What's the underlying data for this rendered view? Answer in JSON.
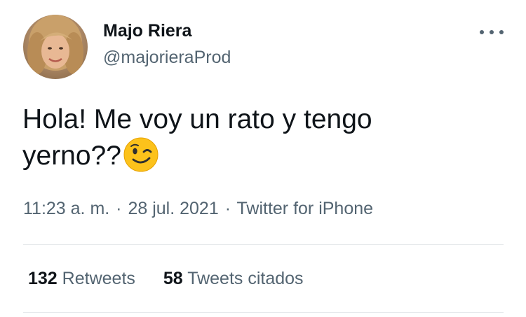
{
  "user": {
    "display_name": "Majo Riera",
    "handle": "@majorieraProd",
    "avatar_icon": "profile-photo"
  },
  "tweet": {
    "text": "Hola! Me voy un rato y tengo yerno??",
    "emoji": "winking-face-emoji"
  },
  "meta": {
    "time": "11:23 a. m.",
    "separator": "·",
    "date": "28 jul. 2021",
    "source": "Twitter for iPhone"
  },
  "stats": {
    "retweets_count": "132",
    "retweets_label": "Retweets",
    "quotes_count": "58",
    "quotes_label": "Tweets citados"
  },
  "icons": {
    "more": "more-horizontal-icon"
  },
  "colors": {
    "text_primary": "#0f1419",
    "text_secondary": "#536471",
    "divider": "#e6e9ec",
    "emoji_yellow": "#fcc21b"
  }
}
